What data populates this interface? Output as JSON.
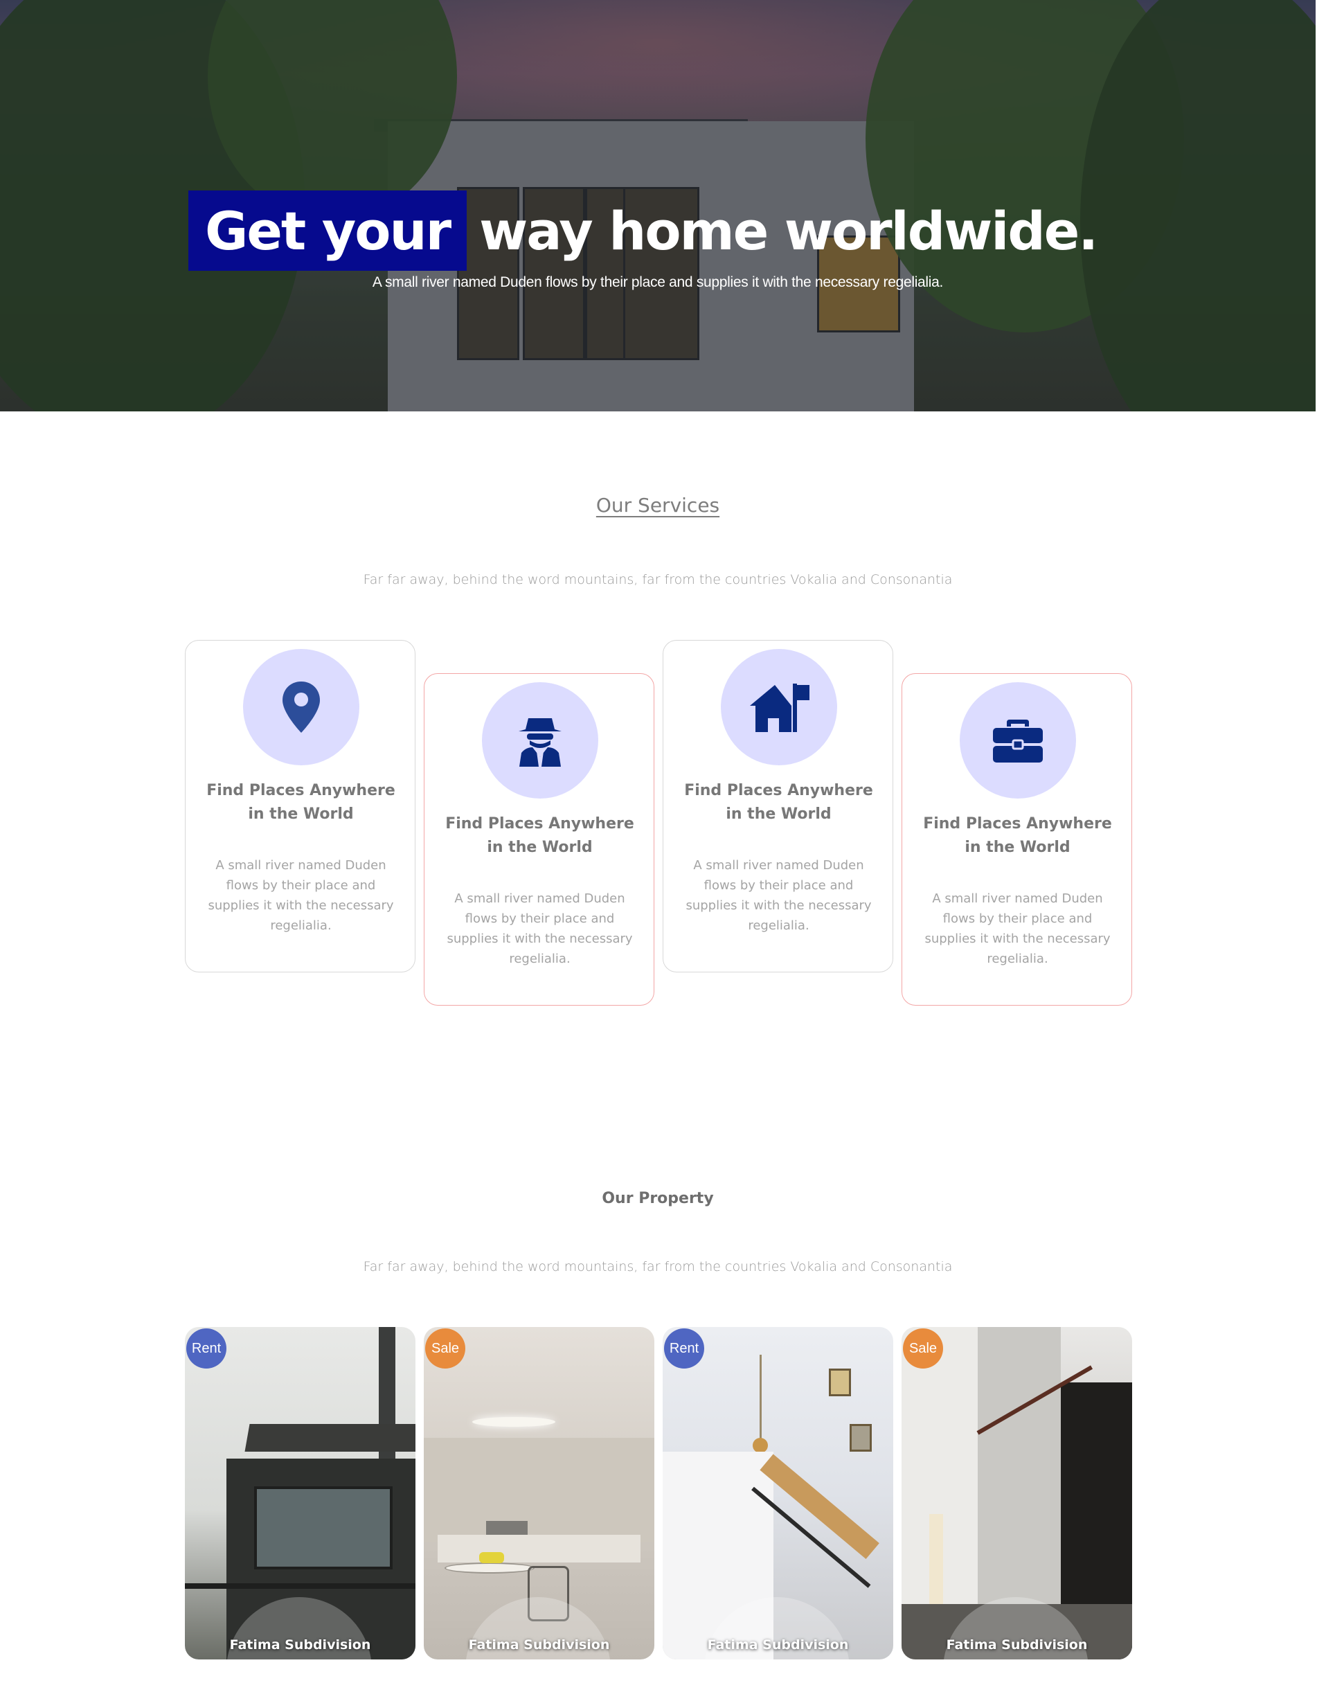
{
  "hero": {
    "title_highlight": "Get your",
    "title_rest": "way home worldwide.",
    "subtitle": "A small river named Duden flows by their place and supplies it with the necessary regelialia.",
    "highlight_color": "#060a8e"
  },
  "services": {
    "title": "Our Services",
    "subtitle": "Far far away, behind the word mountains, far from the countries Vokalia and Consonantia",
    "cards": [
      {
        "icon": "map-marker-icon",
        "title": "Find Places Anywhere in the World",
        "text": "A small river named Duden flows by their place and supplies it with the necessary regelialia."
      },
      {
        "icon": "user-secret-icon",
        "title": "Find Places Anywhere in the World",
        "text": "A small river named Duden flows by their place and supplies it with the necessary regelialia."
      },
      {
        "icon": "house-flag-icon",
        "title": "Find Places Anywhere in the World",
        "text": "A small river named Duden flows by their place and supplies it with the necessary regelialia."
      },
      {
        "icon": "briefcase-icon",
        "title": "Find Places Anywhere in the World",
        "text": "A small river named Duden flows by their place and supplies it with the necessary regelialia."
      }
    ],
    "icon_color": "#0a2a80",
    "circle_color": "#dcdcff"
  },
  "property": {
    "title": "Our Property",
    "subtitle": "Far far away, behind the word mountains, far from the countries Vokalia and Consonantia",
    "items": [
      {
        "badge": "Rent",
        "name": "Fatima Subdivision"
      },
      {
        "badge": "Sale",
        "name": "Fatima Subdivision"
      },
      {
        "badge": "Rent",
        "name": "Fatima Subdivision"
      },
      {
        "badge": "Sale",
        "name": "Fatima Subdivision"
      }
    ],
    "rent_color": "#4f66c2",
    "sale_color": "#e88b3c"
  }
}
